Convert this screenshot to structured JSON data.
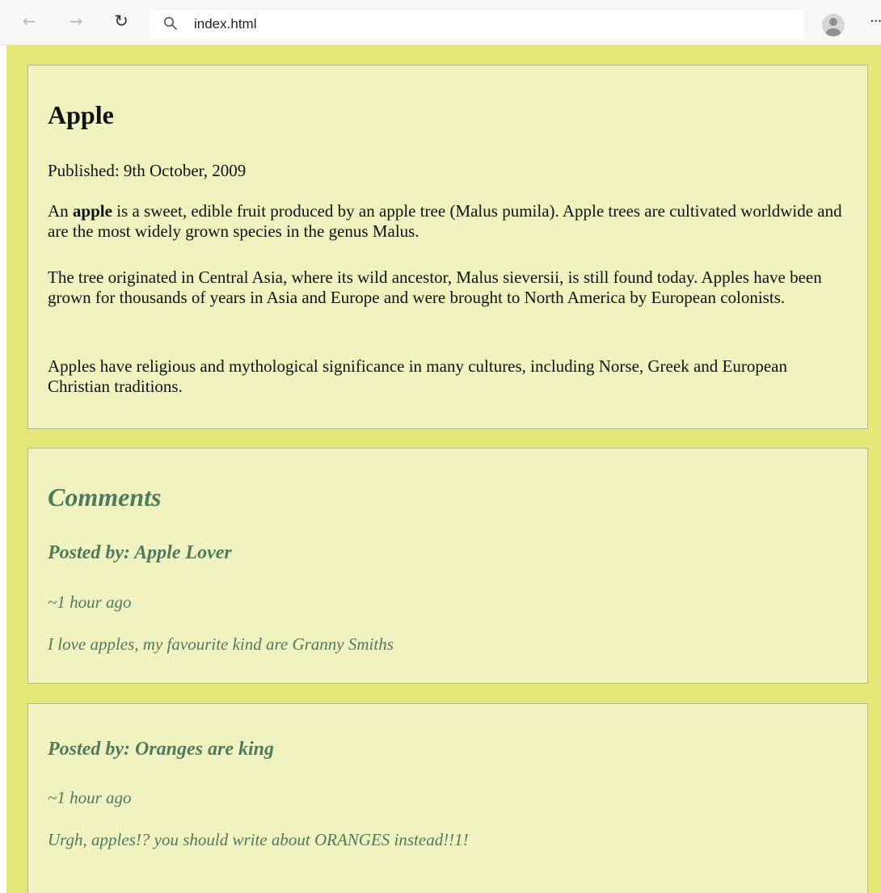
{
  "browser": {
    "address": "index.html",
    "icons": {
      "back": "back-arrow-icon",
      "forward": "forward-arrow-icon",
      "reload": "reload-icon",
      "search": "search-icon",
      "profile": "profile-icon",
      "more": "more-icon"
    }
  },
  "colors": {
    "page_background": "#e4e878",
    "panel_background": "#f0f3c0",
    "comment_text": "#4f7a5d"
  },
  "article": {
    "title": "Apple",
    "published": "Published: 9th October, 2009",
    "paragraph1": {
      "prefix": "An ",
      "bold": "apple",
      "rest": " is a sweet, edible fruit produced by an apple tree (Malus pumila). Apple trees are cultivated worldwide and are the most widely grown species in the genus Malus."
    },
    "paragraph2": "The tree originated in Central Asia, where its wild ancestor, Malus sieversii, is still found today. Apples have been grown for thousands of years in Asia and Europe and were brought to North America by European colonists.",
    "paragraph3": "Apples have religious and mythological significance in many cultures, including Norse, Greek and European Christian traditions."
  },
  "comments": {
    "heading": "Comments",
    "items": [
      {
        "poster": "Posted by: Apple Lover",
        "time": "~1 hour ago",
        "text": "I love apples, my favourite kind are Granny Smiths"
      },
      {
        "poster": "Posted by: Oranges are king",
        "time": "~1 hour ago",
        "text": "Urgh, apples!? you should write about ORANGES instead!!1!"
      }
    ]
  }
}
